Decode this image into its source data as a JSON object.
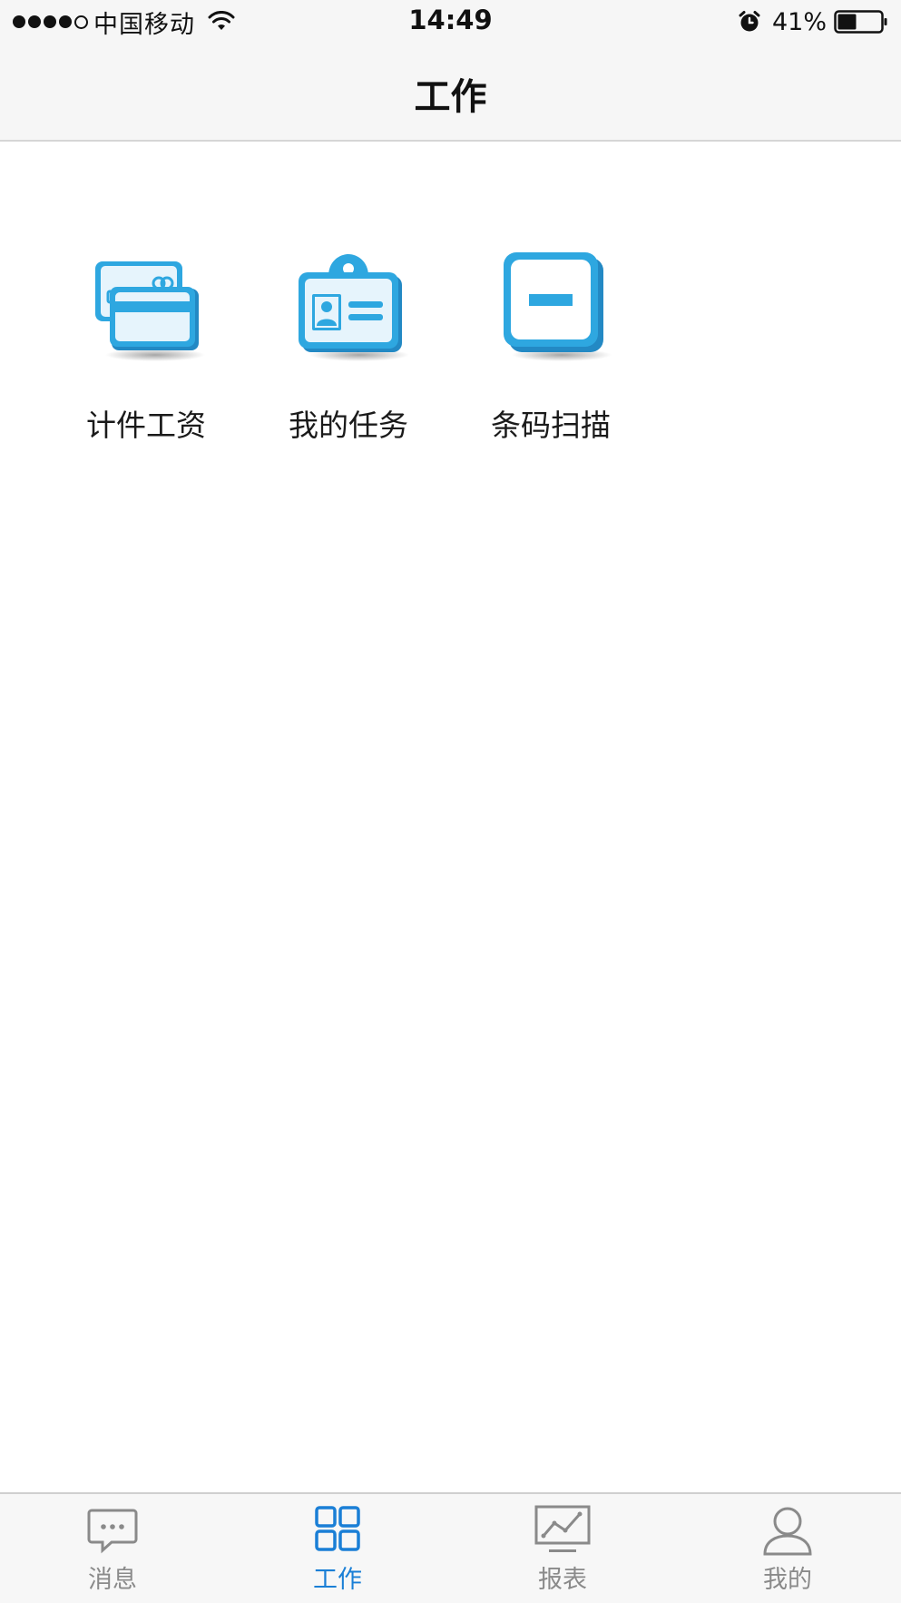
{
  "status_bar": {
    "carrier": "中国移动",
    "time": "14:49",
    "battery": "41%"
  },
  "header": {
    "title": "工作"
  },
  "apps": [
    {
      "label": "计件工资",
      "icon": "cards-icon"
    },
    {
      "label": "我的任务",
      "icon": "id-badge-icon"
    },
    {
      "label": "条码扫描",
      "icon": "barcode-scan-icon"
    }
  ],
  "tabs": [
    {
      "label": "消息",
      "icon": "chat-icon",
      "active": false
    },
    {
      "label": "工作",
      "icon": "grid-icon",
      "active": true
    },
    {
      "label": "报表",
      "icon": "chart-icon",
      "active": false
    },
    {
      "label": "我的",
      "icon": "user-icon",
      "active": false
    }
  ],
  "colors": {
    "accent": "#1a7fd6",
    "icon_blue": "#2ea7e0",
    "tab_inactive": "#8a8a8a"
  }
}
